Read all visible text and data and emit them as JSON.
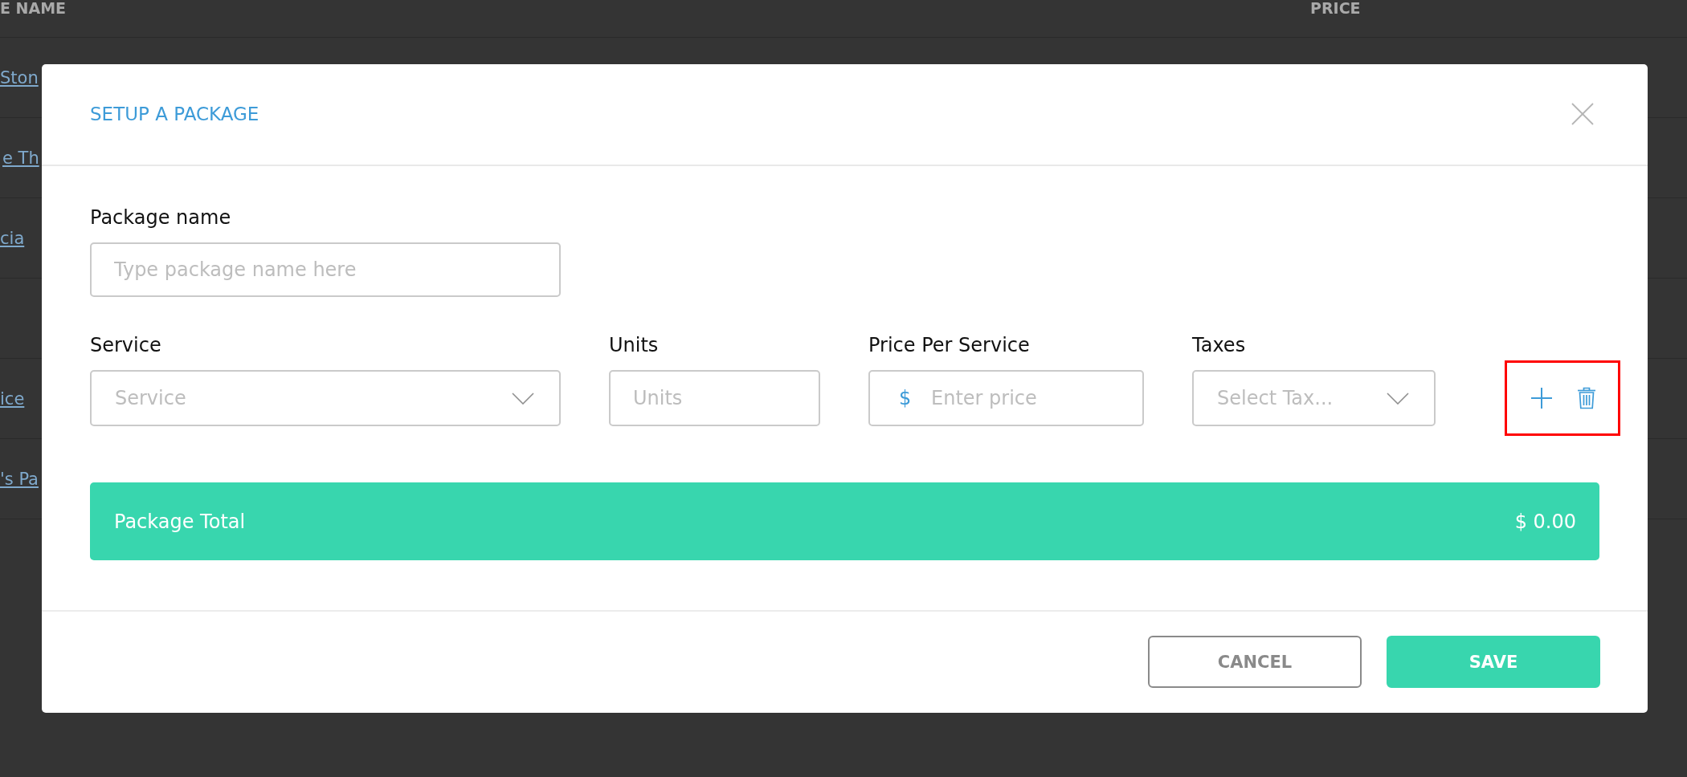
{
  "background": {
    "columns": [
      "E NAME",
      "PRICE"
    ],
    "rows": [
      {
        "name": "Ston"
      },
      {
        "name": "e Th"
      },
      {
        "name": "cia"
      },
      {},
      {
        "name": "ice"
      },
      {
        "name": "'s Pa"
      }
    ]
  },
  "modal": {
    "title": "SETUP A PACKAGE",
    "package_name": {
      "label": "Package name",
      "placeholder": "Type package name here"
    },
    "fields": [
      {
        "kind": "select",
        "label": "Service",
        "placeholder": "Service"
      },
      {
        "kind": "text",
        "label": "Units",
        "placeholder": "Units"
      },
      {
        "kind": "currency",
        "label": "Price Per Service",
        "prefix": "$",
        "placeholder": "Enter price"
      },
      {
        "kind": "select",
        "label": "Taxes",
        "placeholder": "Select Tax..."
      }
    ],
    "row_actions": {
      "highlighted": true
    },
    "total": {
      "label": "Package Total",
      "value": "$ 0.00"
    },
    "buttons": [
      {
        "kind": "secondary",
        "label": "CANCEL"
      },
      {
        "kind": "primary",
        "label": "SAVE"
      }
    ]
  }
}
